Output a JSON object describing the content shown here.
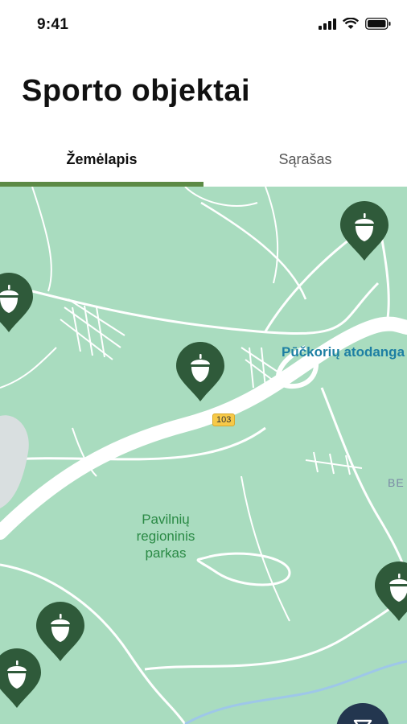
{
  "status_bar": {
    "time": "9:41"
  },
  "header": {
    "title": "Sporto objektai"
  },
  "tabs": [
    {
      "label": "Žemėlapis",
      "active": true
    },
    {
      "label": "Sąrašas",
      "active": false
    }
  ],
  "map": {
    "park_label": "Pavilnių\nregioninis\nparkas",
    "poi_label": "Pūčkorių atodanga",
    "road_shield": "103",
    "edge_label": "BE",
    "marker_icon": "acorn-icon",
    "marker_color": "#2f5a3a",
    "map_color": "#a9dcbf",
    "accent_color": "#5c8a45"
  }
}
